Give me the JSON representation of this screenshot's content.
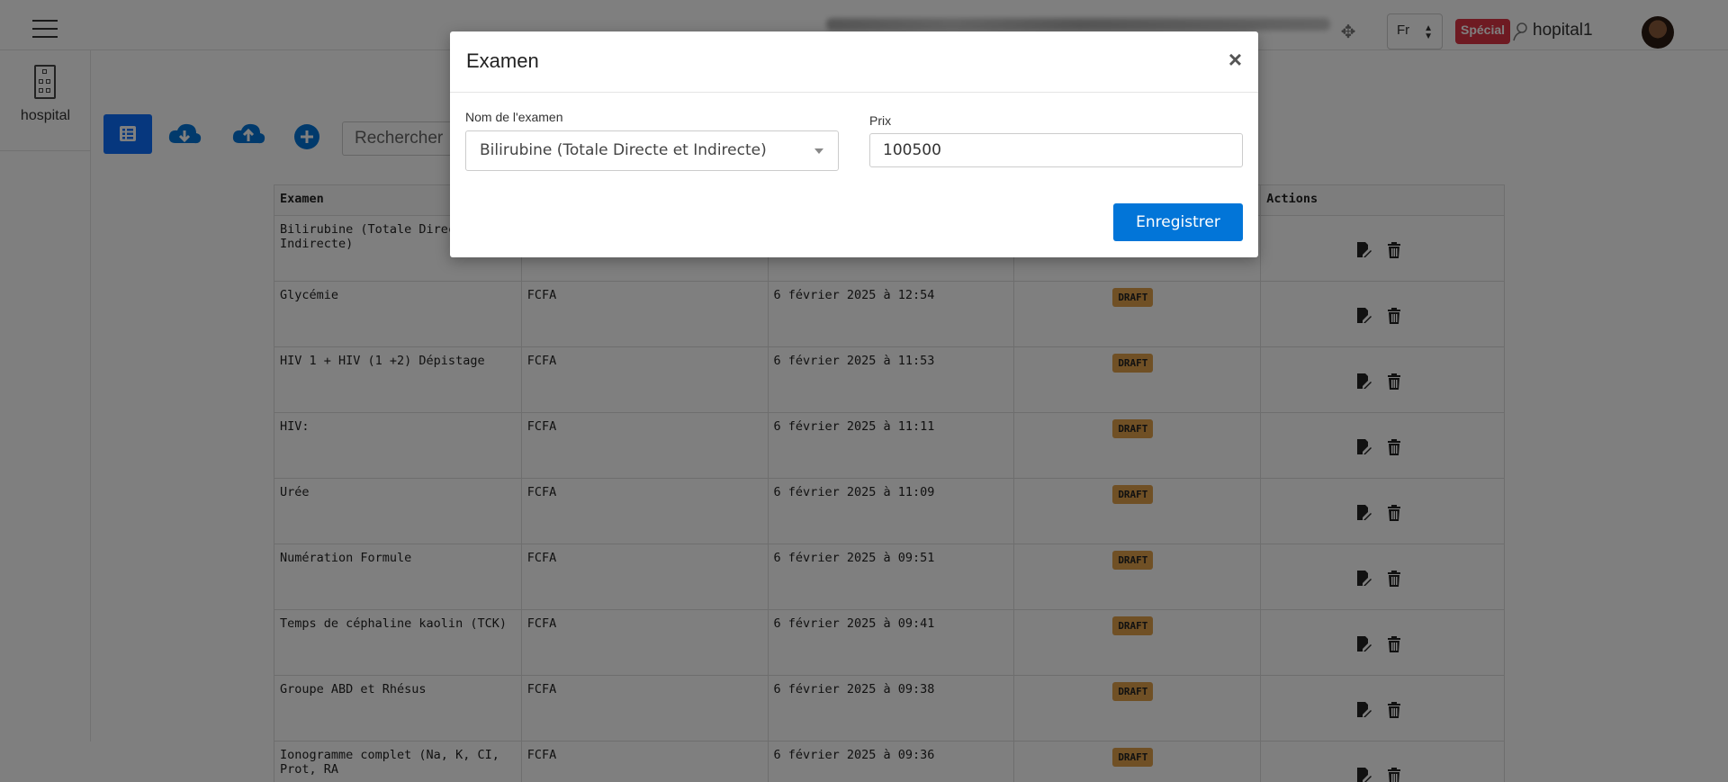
{
  "topbar": {
    "language": "Fr",
    "badge": "Spécial",
    "username": "hopital1"
  },
  "sidebar": {
    "brand_label": "hospital"
  },
  "toolbar": {
    "search_placeholder": "Rechercher"
  },
  "table": {
    "headers": [
      "Examen",
      "",
      "",
      "",
      "Actions"
    ],
    "rows": [
      {
        "examen": "Bilirubine (Totale Directe et Indirecte)",
        "devise": "",
        "date": "",
        "status": ""
      },
      {
        "examen": "Glycémie",
        "devise": "FCFA",
        "date": "6 février 2025 à 12:54",
        "status": "DRAFT"
      },
      {
        "examen": "HIV 1 + HIV (1 +2) Dépistage",
        "devise": "FCFA",
        "date": "6 février 2025 à 11:53",
        "status": "DRAFT"
      },
      {
        "examen": "HIV:",
        "devise": "FCFA",
        "date": "6 février 2025 à 11:11",
        "status": "DRAFT"
      },
      {
        "examen": "Urée",
        "devise": "FCFA",
        "date": "6 février 2025 à 11:09",
        "status": "DRAFT"
      },
      {
        "examen": "Numération Formule",
        "devise": "FCFA",
        "date": "6 février 2025 à 09:51",
        "status": "DRAFT"
      },
      {
        "examen": "Temps de céphaline kaolin (TCK)",
        "devise": "FCFA",
        "date": "6 février 2025 à 09:41",
        "status": "DRAFT"
      },
      {
        "examen": "Groupe ABD et Rhésus",
        "devise": "FCFA",
        "date": "6 février 2025 à 09:38",
        "status": "DRAFT"
      },
      {
        "examen": "Ionogramme complet (Na, K, CI, Prot, RA",
        "devise": "FCFA",
        "date": "6 février 2025 à 09:36",
        "status": "DRAFT"
      }
    ]
  },
  "modal": {
    "title": "Examen",
    "close": "×",
    "exam_label": "Nom de l'examen",
    "exam_value": "Bilirubine (Totale Directe et Indirecte)",
    "price_label": "Prix",
    "price_value": "100500",
    "save_label": "Enregistrer"
  },
  "colors": {
    "primary": "#0275d8",
    "draft": "#e0a04a",
    "badge": "#dc3545"
  }
}
